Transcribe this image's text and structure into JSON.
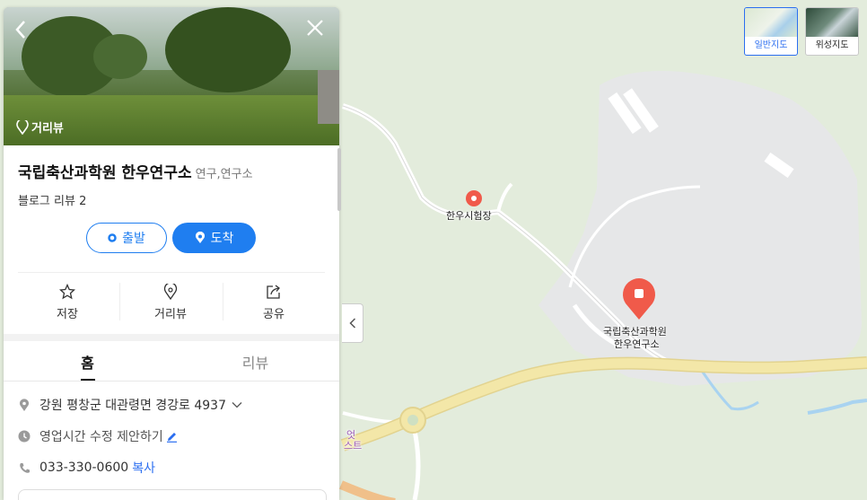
{
  "map": {
    "labels": {
      "trial_site": "한우시험장",
      "main_place_line1": "국립축산과학원",
      "main_place_line2": "한우연구소",
      "partial_label_1": "엇",
      "partial_label_2": "스트"
    },
    "map_types": [
      {
        "label": "일반지도",
        "active": true
      },
      {
        "label": "위성지도",
        "active": false
      }
    ],
    "colors": {
      "land": "#e3ecdc",
      "facility_area": "#e6e7e8",
      "highway": "#f3e7a8",
      "road": "#ffffff",
      "water": "#a9d3f0",
      "marker": "#f05a4a"
    }
  },
  "panel": {
    "hero": {
      "street_view_label": "거리뷰"
    },
    "title": "국립축산과학원 한우연구소",
    "category": "연구,연구소",
    "review_count": "블로그 리뷰 2",
    "buttons": {
      "start": "출발",
      "arrive": "도착"
    },
    "actions": [
      {
        "label": "저장",
        "icon": "star-icon"
      },
      {
        "label": "거리뷰",
        "icon": "location-pin-icon"
      },
      {
        "label": "공유",
        "icon": "share-icon"
      }
    ],
    "tabs": [
      {
        "label": "홈",
        "active": true
      },
      {
        "label": "리뷰",
        "active": false
      }
    ],
    "info": {
      "address": "강원 평창군 대관령면 경강로 4937",
      "hours": "영업시간 수정 제안하기",
      "phone": "033-330-0600",
      "copy": "복사"
    }
  }
}
